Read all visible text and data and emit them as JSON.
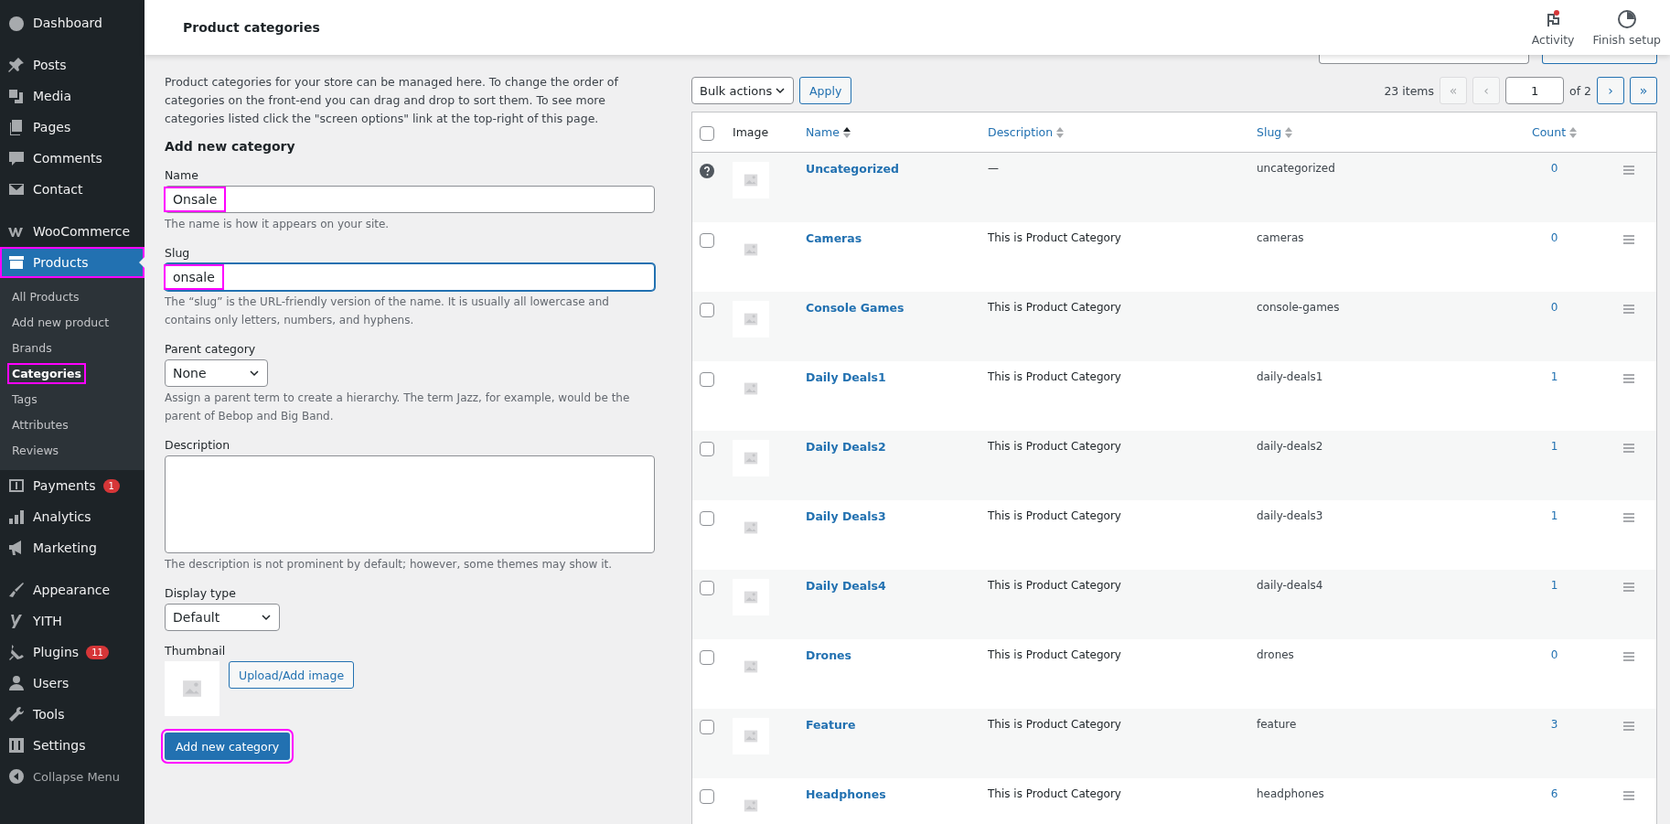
{
  "sidebar": {
    "items": [
      {
        "kind": "item",
        "label": "Dashboard",
        "selected": false
      },
      {
        "kind": "item",
        "label": "Posts",
        "selected": false
      },
      {
        "kind": "item",
        "label": "Media",
        "selected": false
      },
      {
        "kind": "item",
        "label": "Pages",
        "selected": false
      },
      {
        "kind": "item",
        "label": "Comments",
        "selected": false
      },
      {
        "kind": "item",
        "label": "Contact",
        "selected": false
      },
      {
        "kind": "item",
        "label": "WooCommerce",
        "selected": false
      },
      {
        "kind": "item",
        "label": "Products",
        "selected": true,
        "highlighted": true,
        "children": [
          {
            "label": "All Products",
            "selected": false,
            "highlighted": false
          },
          {
            "label": "Add new product",
            "selected": false,
            "highlighted": false
          },
          {
            "label": "Brands",
            "selected": false,
            "highlighted": false
          },
          {
            "label": "Categories",
            "selected": true,
            "highlighted": true
          },
          {
            "label": "Tags",
            "selected": false,
            "highlighted": false
          },
          {
            "label": "Attributes",
            "selected": false,
            "highlighted": false
          },
          {
            "label": "Reviews",
            "selected": false,
            "highlighted": false
          }
        ]
      },
      {
        "kind": "item",
        "label": "Payments",
        "badge": "1",
        "selected": false
      },
      {
        "kind": "item",
        "label": "Analytics",
        "selected": false
      },
      {
        "kind": "item",
        "label": "Marketing",
        "selected": false
      },
      {
        "kind": "item",
        "label": "Appearance",
        "selected": false
      },
      {
        "kind": "item",
        "label": "YITH",
        "selected": false
      },
      {
        "kind": "item",
        "label": "Plugins",
        "badge": "11",
        "selected": false
      },
      {
        "kind": "item",
        "label": "Users",
        "selected": false
      },
      {
        "kind": "item",
        "label": "Tools",
        "selected": false
      },
      {
        "kind": "item",
        "label": "Settings",
        "selected": false
      },
      {
        "kind": "collapse",
        "label": "Collapse Menu",
        "selected": false
      }
    ]
  },
  "header": {
    "title": "Product categories",
    "actions": [
      {
        "kind": "flag",
        "label": "Activity",
        "dot": true
      },
      {
        "kind": "pie",
        "label": "Finish setup",
        "dot": false
      }
    ]
  },
  "intro": "Product categories for your store can be managed here. To change the order of categories on the front-end you can drag and drop to sort them. To see more categories listed click the \"screen options\" link at the top-right of this page.",
  "form": {
    "heading": "Add new category",
    "name": {
      "label": "Name",
      "value": "Onsale",
      "help": "The name is how it appears on your site.",
      "highlighted": true
    },
    "slug": {
      "label": "Slug",
      "value": "onsale",
      "help": "The “slug” is the URL-friendly version of the name. It is usually all lowercase and contains only letters, numbers, and hyphens.",
      "highlighted": true,
      "focused": true
    },
    "parent": {
      "label": "Parent category",
      "value": "None",
      "help": "Assign a parent term to create a hierarchy. The term Jazz, for example, would be the parent of Bebop and Big Band."
    },
    "description": {
      "label": "Description",
      "help": "The description is not prominent by default; however, some themes may show it."
    },
    "display_type": {
      "label": "Display type",
      "value": "Default"
    },
    "thumbnail": {
      "label": "Thumbnail",
      "button": "Upload/Add image"
    },
    "submit": {
      "label": "Add new category",
      "highlighted": true
    }
  },
  "toolbar": {
    "bulk": "Bulk actions",
    "apply": "Apply",
    "items": "23 items",
    "first": "«",
    "prev": "‹",
    "page": "1",
    "of": "of 2",
    "next": "›",
    "last": "»"
  },
  "table": {
    "columns": [
      {
        "kind": "check",
        "checked": false
      },
      {
        "kind": "plain",
        "label": "Image"
      },
      {
        "kind": "sort",
        "label": "Name",
        "sorted": true
      },
      {
        "kind": "sort",
        "label": "Description",
        "sorted": false
      },
      {
        "kind": "sort",
        "label": "Slug",
        "sorted": false
      },
      {
        "kind": "sort",
        "label": "Count",
        "sorted": false
      }
    ],
    "rows": [
      {
        "kind": "default",
        "name": "Uncategorized",
        "description": "—",
        "slug": "uncategorized",
        "count": "0"
      },
      {
        "kind": "normal",
        "checked": false,
        "name": "Cameras",
        "description": "This is Product Category",
        "slug": "cameras",
        "count": "0"
      },
      {
        "kind": "normal",
        "checked": false,
        "name": "Console Games",
        "description": "This is Product Category",
        "slug": "console-games",
        "count": "0"
      },
      {
        "kind": "normal",
        "checked": false,
        "name": "Daily Deals1",
        "description": "This is Product Category",
        "slug": "daily-deals1",
        "count": "1"
      },
      {
        "kind": "normal",
        "checked": false,
        "name": "Daily Deals2",
        "description": "This is Product Category",
        "slug": "daily-deals2",
        "count": "1"
      },
      {
        "kind": "normal",
        "checked": false,
        "name": "Daily Deals3",
        "description": "This is Product Category",
        "slug": "daily-deals3",
        "count": "1"
      },
      {
        "kind": "normal",
        "checked": false,
        "name": "Daily Deals4",
        "description": "This is Product Category",
        "slug": "daily-deals4",
        "count": "1"
      },
      {
        "kind": "normal",
        "checked": false,
        "name": "Drones",
        "description": "This is Product Category",
        "slug": "drones",
        "count": "0"
      },
      {
        "kind": "normal",
        "checked": false,
        "name": "Feature",
        "description": "This is Product Category",
        "slug": "feature",
        "count": "3"
      },
      {
        "kind": "normal",
        "checked": false,
        "name": "Headphones",
        "description": "This is Product Category",
        "slug": "headphones",
        "count": "6"
      }
    ]
  }
}
